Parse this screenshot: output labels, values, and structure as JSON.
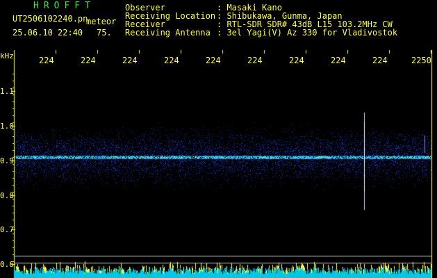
{
  "header": {
    "program": "HROFFT",
    "filename": "UT2506102240.pn",
    "meteor_label": "meteor",
    "datetime": "25.06.10 22:40",
    "count": "75.",
    "fields": [
      {
        "label": "Observer",
        "value": ": Masaki Kano"
      },
      {
        "label": "Receiving Location",
        "value": ": Shibukawa, Gunma, Japan"
      },
      {
        "label": "Receiver",
        "value": ": RTL-SDR SDR# 43dB L15 103.2MHz CW"
      },
      {
        "label": "Receiving Antenna",
        "value": ": 3el Yagi(V) Az 330 for Vladivostok"
      }
    ]
  },
  "time_axis": {
    "labels": [
      "224",
      "224",
      "224",
      "224",
      "224",
      "224",
      "224",
      "224",
      "224",
      "2250"
    ]
  },
  "freq_axis": {
    "unit": "kHz",
    "labels": [
      "1.1",
      "1.0",
      "0.9",
      "0.8",
      "0.7",
      "0.6"
    ]
  },
  "colors": {
    "text": "#ffff40",
    "title": "#2ee83a",
    "noise": "#1a2ad8",
    "carrier": "#4ff0ff",
    "meteor": "#ffffff"
  }
}
